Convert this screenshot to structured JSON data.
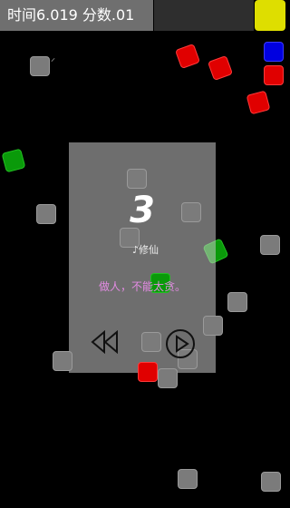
{
  "hud": {
    "status_text": "时间6.019 分数.01",
    "accent_button_color": "#dede00"
  },
  "overlay": {
    "countdown": "3",
    "subtitle": "修仙",
    "motto": "做人，不能太贪。",
    "rewind_icon": "rewind-icon",
    "play_icon": "play-circle-icon"
  }
}
